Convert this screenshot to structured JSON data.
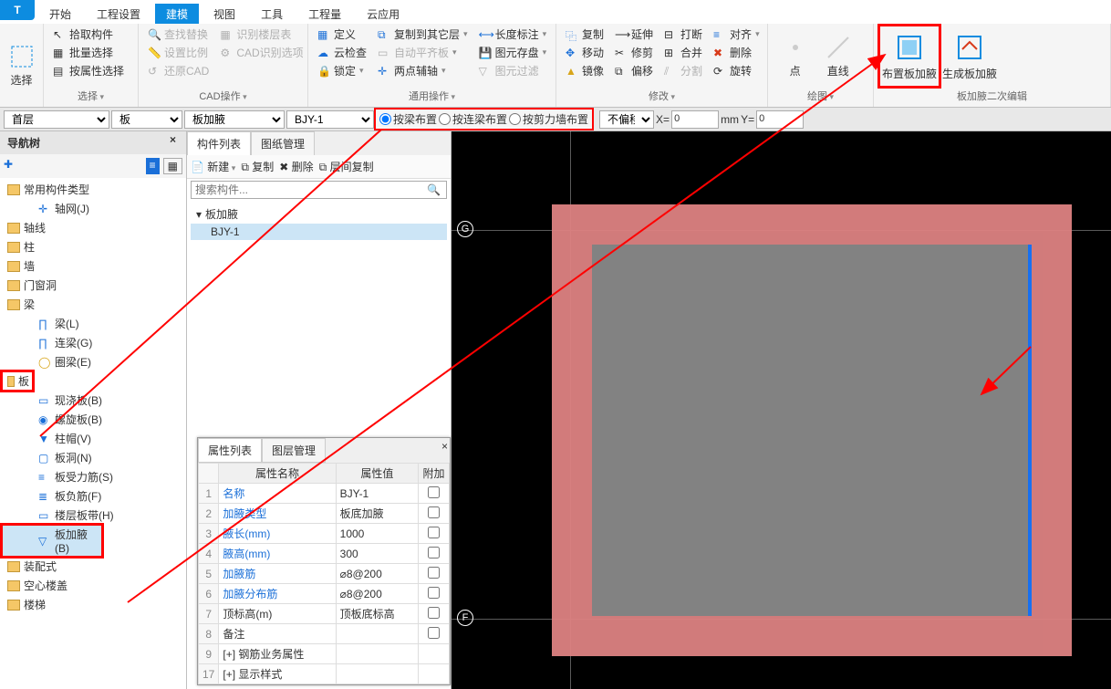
{
  "app": {
    "icon": "T"
  },
  "menu": [
    "开始",
    "工程设置",
    "建模",
    "视图",
    "工具",
    "工程量",
    "云应用"
  ],
  "menu_active": 2,
  "ribbon": {
    "select": {
      "big": "选择",
      "items": [
        "拾取构件",
        "批量选择",
        "按属性选择"
      ],
      "label": "选择"
    },
    "cad": {
      "items": [
        [
          "查找替换",
          "识别楼层表"
        ],
        [
          "设置比例",
          "CAD识别选项"
        ],
        [
          "还原CAD",
          ""
        ]
      ],
      "label": "CAD操作"
    },
    "define": {
      "items": [
        [
          "定义",
          ""
        ],
        [
          "云检查",
          ""
        ],
        [
          "锁定",
          "两点辅轴"
        ]
      ],
      "col2": [
        "自动平齐板"
      ],
      "label": "通用操作"
    },
    "copy": {
      "items": [
        "复制到其它层",
        "图元存盘",
        "图元过滤"
      ]
    },
    "dim": {
      "items": [
        "长度标注"
      ]
    },
    "modify_left": [
      [
        "复制",
        "延伸",
        "打断",
        "对齐"
      ],
      [
        "移动",
        "修剪",
        "合并",
        "删除"
      ],
      [
        "镜像",
        "偏移",
        "分割",
        "旋转"
      ]
    ],
    "modify_label": "修改",
    "draw_items": [
      "点",
      "直线"
    ],
    "draw_label": "绘图",
    "rightbtns": [
      "布置板加腋",
      "生成板加腋"
    ],
    "right_label": "板加腋二次编辑"
  },
  "secondbar": {
    "floor": "首层",
    "cat": "板",
    "sub": "板加腋",
    "comp": "BJY-1",
    "radios": [
      "按梁布置",
      "按连梁布置",
      "按剪力墙布置"
    ],
    "offset_label": "不偏移",
    "x_label": "X=",
    "x_val": "0",
    "unit": "mm",
    "y_label": "Y=",
    "y_val": "0"
  },
  "nav": {
    "title": "导航树",
    "root": "常用构件类型",
    "axis_root": "轴网(J)",
    "groups": [
      "轴线",
      "柱",
      "墙",
      "门窗洞"
    ],
    "beam": {
      "label": "梁",
      "items": [
        "梁(L)",
        "连梁(G)",
        "圈梁(E)"
      ]
    },
    "slab": {
      "label": "板",
      "items": [
        "现浇板(B)",
        "螺旋板(B)",
        "柱帽(V)",
        "板洞(N)",
        "板受力筋(S)",
        "板负筋(F)",
        "楼层板带(H)",
        "板加腋(B)"
      ]
    },
    "others": [
      "装配式",
      "空心楼盖",
      "楼梯"
    ]
  },
  "mid": {
    "tabs": [
      "构件列表",
      "图纸管理"
    ],
    "toolbar": [
      "新建",
      "复制",
      "删除",
      "层间复制"
    ],
    "search_ph": "搜索构件...",
    "root": "板加腋",
    "item": "BJY-1"
  },
  "prop": {
    "tabs": [
      "属性列表",
      "图层管理"
    ],
    "headers": [
      "属性名称",
      "属性值",
      "附加"
    ],
    "rows": [
      {
        "n": "1",
        "name": "名称",
        "val": "BJY-1",
        "link": true
      },
      {
        "n": "2",
        "name": "加腋类型",
        "val": "板底加腋",
        "link": true
      },
      {
        "n": "3",
        "name": "腋长(mm)",
        "val": "1000",
        "link": true
      },
      {
        "n": "4",
        "name": "腋高(mm)",
        "val": "300",
        "link": true
      },
      {
        "n": "5",
        "name": "加腋筋",
        "val": "⌀8@200",
        "link": true
      },
      {
        "n": "6",
        "name": "加腋分布筋",
        "val": "⌀8@200",
        "link": true
      },
      {
        "n": "7",
        "name": "顶标高(m)",
        "val": "顶板底标高",
        "link": false
      },
      {
        "n": "8",
        "name": "备注",
        "val": "",
        "link": false
      },
      {
        "n": "9",
        "name": "钢筋业务属性",
        "val": "",
        "link": false,
        "exp": "+"
      },
      {
        "n": "17",
        "name": "显示样式",
        "val": "",
        "link": false,
        "exp": "+"
      }
    ]
  },
  "viewport": {
    "g": "G",
    "f": "F"
  }
}
